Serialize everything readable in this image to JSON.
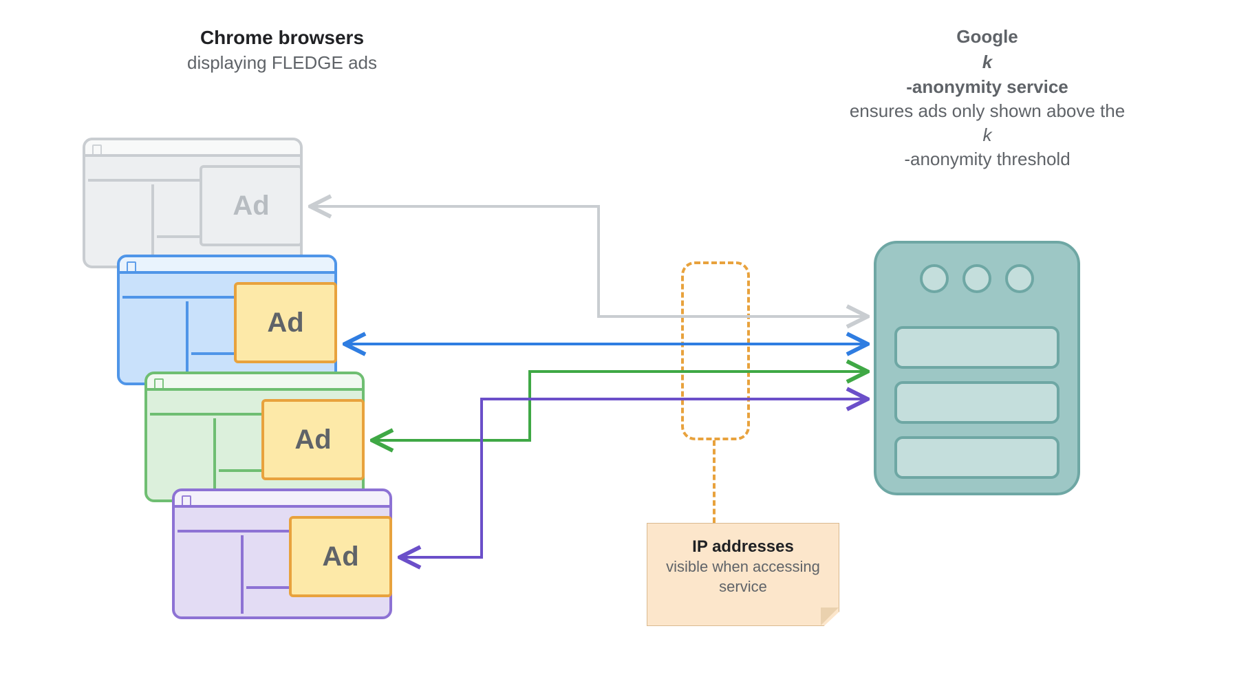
{
  "headings": {
    "left_bold": "Chrome browsers",
    "left_sub": "displaying FLEDGE ads",
    "right_bold_pre": "Google ",
    "right_bold_it": "k",
    "right_bold_post": "-anonymity service",
    "right_sub_pre": "ensures ads only shown above the ",
    "right_sub_it": "k",
    "right_sub_post": "-anonymity threshold"
  },
  "ad_label": "Ad",
  "ip_note": {
    "title": "IP addresses",
    "line": "visible when accessing service"
  },
  "browsers": [
    {
      "id": "win0",
      "color": "grey",
      "active": false
    },
    {
      "id": "win1",
      "color": "blue",
      "active": true
    },
    {
      "id": "win2",
      "color": "green",
      "active": true
    },
    {
      "id": "win3",
      "color": "purple",
      "active": true
    }
  ],
  "arrows": [
    {
      "from": "win0",
      "color": "#C9CDD1"
    },
    {
      "from": "win1",
      "color": "#2F7DE1"
    },
    {
      "from": "win2",
      "color": "#3FA845"
    },
    {
      "from": "win3",
      "color": "#6B4FC9"
    }
  ],
  "colors": {
    "ad_fill": "#FDE9A8",
    "ad_border": "#E8A23D",
    "server_fill": "#9DC7C5",
    "server_border": "#6EA7A4",
    "note_fill": "#FCE6CB"
  }
}
